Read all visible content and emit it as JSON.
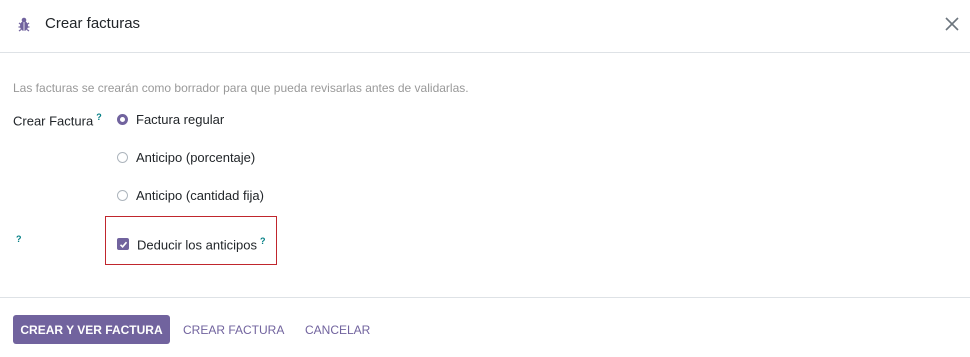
{
  "dialog": {
    "title": "Crear facturas",
    "icon": "bug-icon",
    "close_icon": "close-icon"
  },
  "notice": "Las facturas se crearán como borrador para que pueda revisarlas antes de validarlas.",
  "field": {
    "label": "Crear Factura",
    "help": "?"
  },
  "options": [
    {
      "label": "Factura regular",
      "checked": true
    },
    {
      "label": "Anticipo (porcentaje)",
      "checked": false
    },
    {
      "label": "Anticipo (cantidad fija)",
      "checked": false
    }
  ],
  "deduct": {
    "label": "Deducir los anticipos",
    "help": "?",
    "row_help": "?",
    "checked": true
  },
  "footer": {
    "primary": "CREAR Y VER FACTURA",
    "secondary": "CREAR FACTURA",
    "cancel": "CANCELAR"
  },
  "colors": {
    "accent": "#71639e",
    "help": "#017e84",
    "highlight": "#c0262d"
  }
}
